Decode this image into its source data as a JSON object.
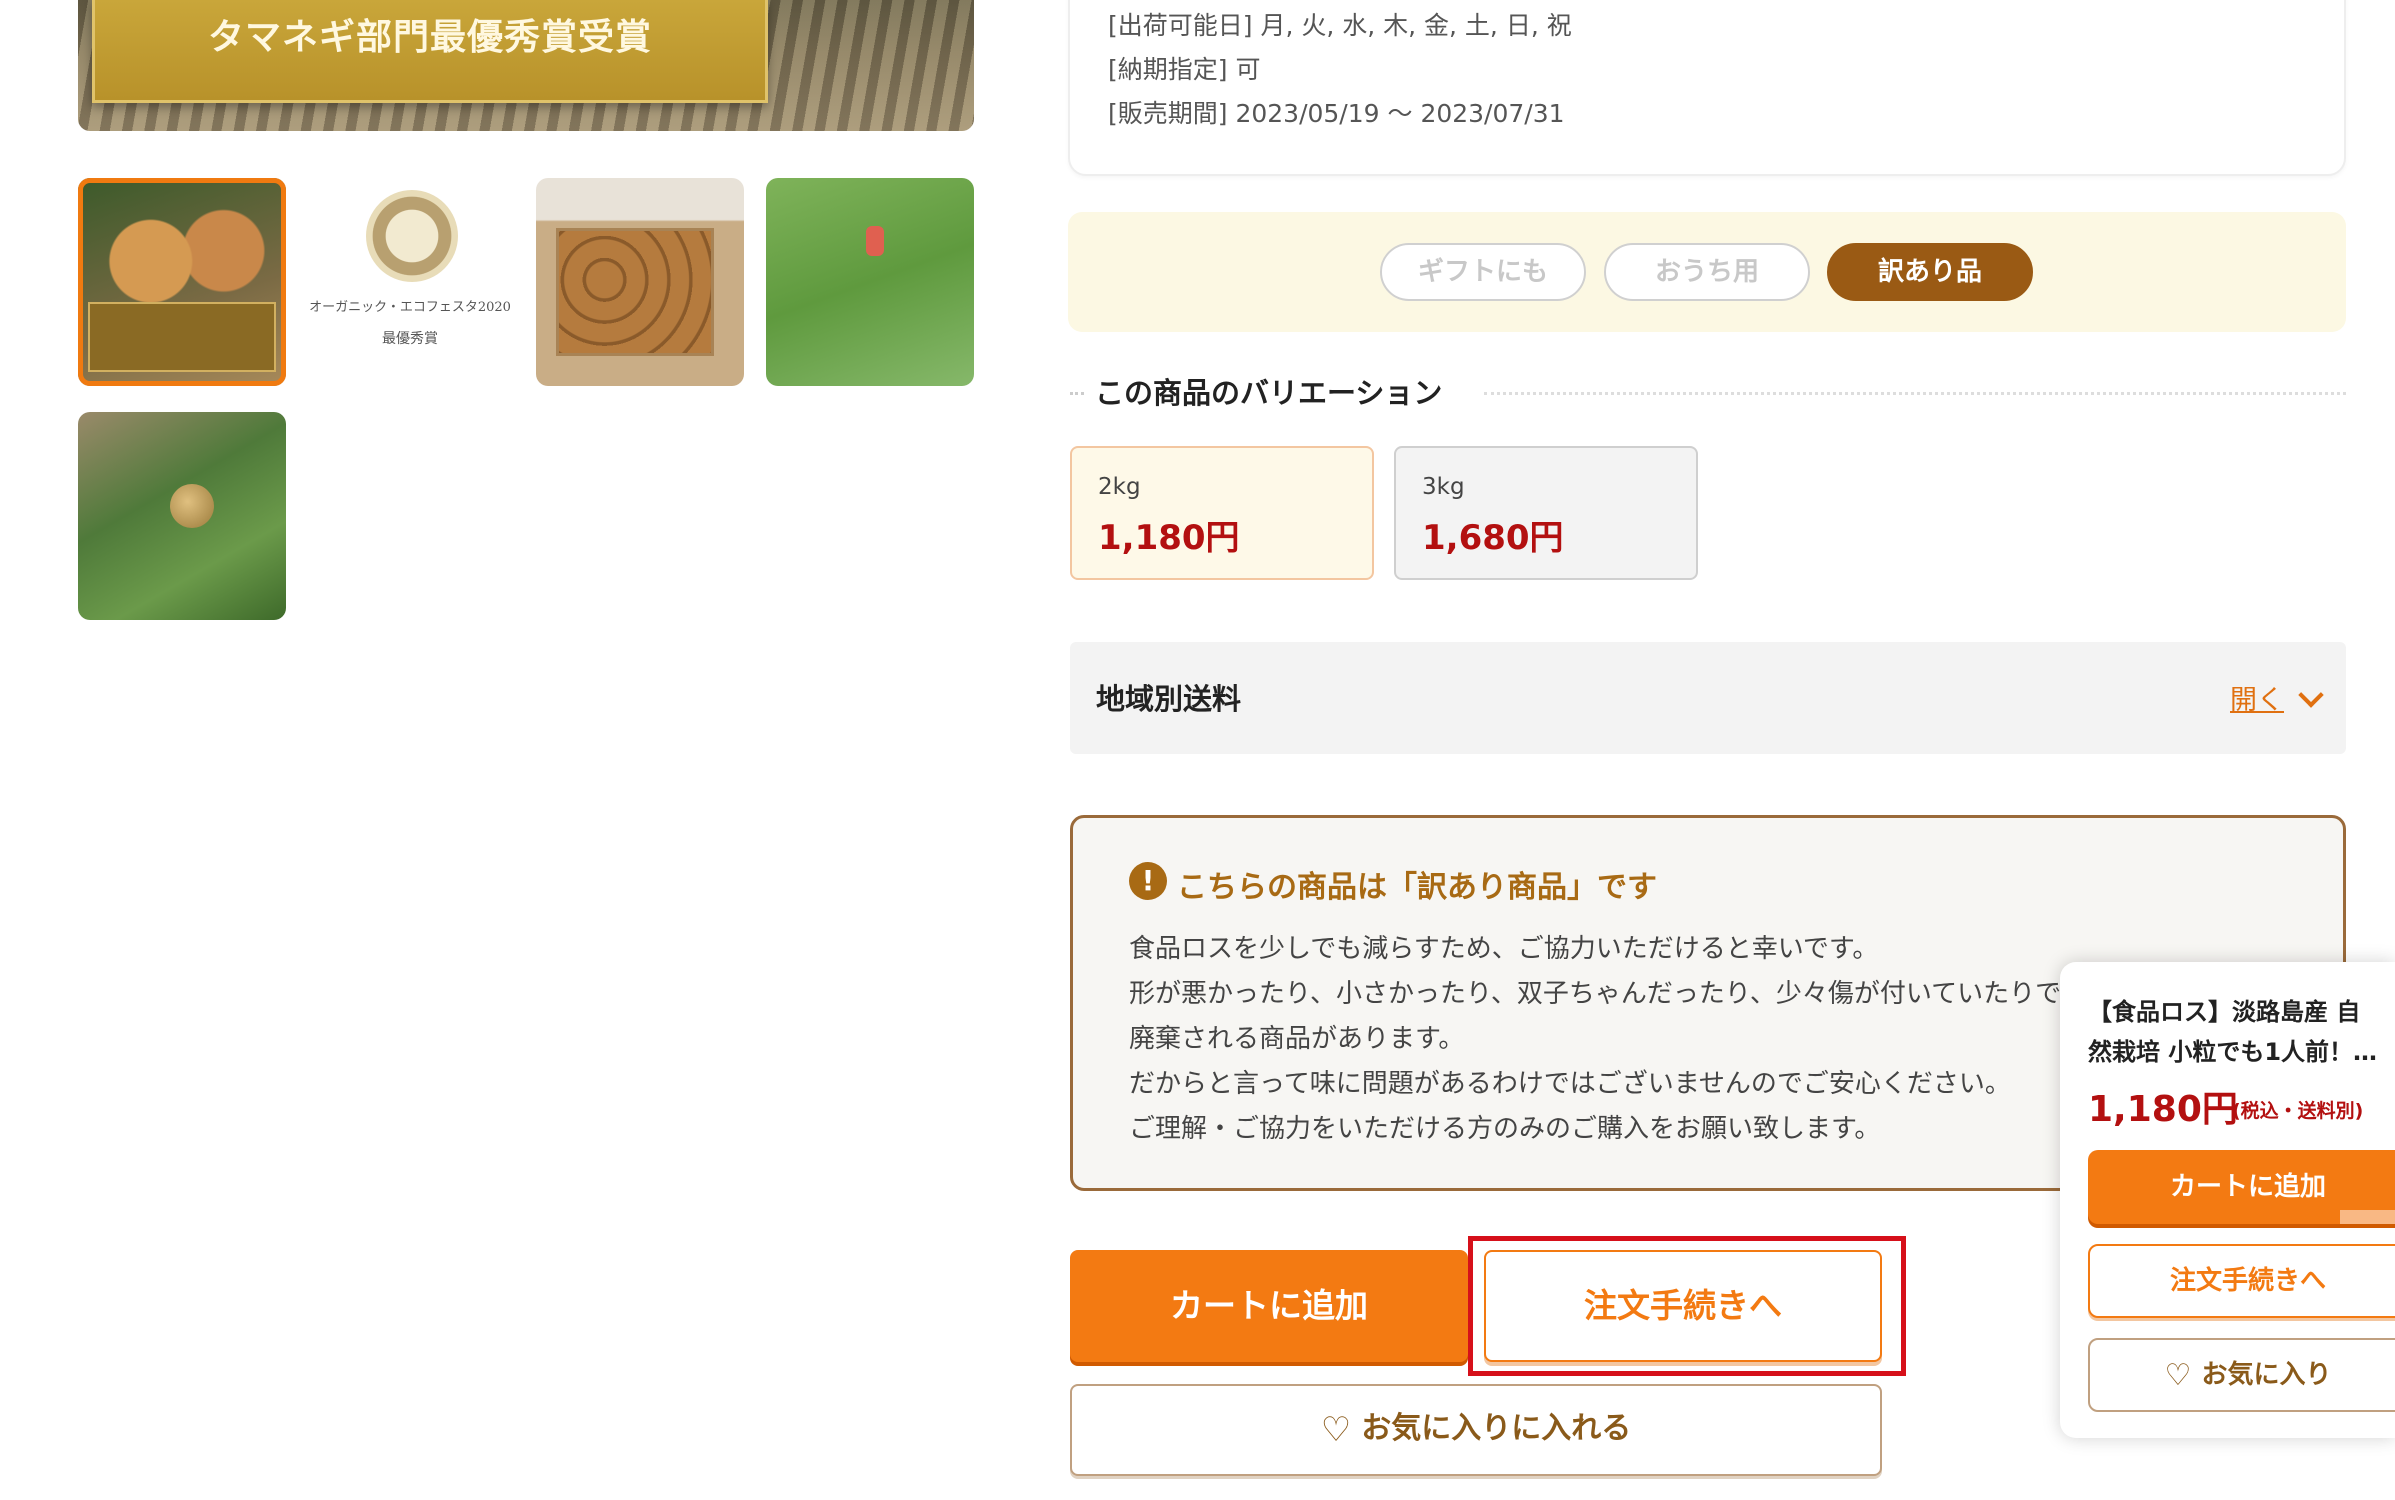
{
  "gallery": {
    "hero_banner_text": "タマネギ部門最優秀賞受賞",
    "thumb2_lines": [
      "オーガニック・エコフェスタ2020",
      "最優秀賞"
    ]
  },
  "spec": {
    "ship_days": "[出荷可能日] 月, 火, 水, 木, 金, 土, 日, 祝",
    "delivery_date": "[納期指定] 可",
    "sale_period": "[販売期間] 2023/05/19 〜 2023/07/31"
  },
  "tags": [
    {
      "label": "ギフトにも",
      "active": false
    },
    {
      "label": "おうち用",
      "active": false
    },
    {
      "label": "訳あり品",
      "active": true
    }
  ],
  "variations": {
    "title": "この商品のバリエーション",
    "items": [
      {
        "weight": "2kg",
        "price": "1,180円",
        "selected": true
      },
      {
        "weight": "3kg",
        "price": "1,680円",
        "selected": false
      }
    ]
  },
  "shipping": {
    "label": "地域別送料",
    "toggle": "開く"
  },
  "notice": {
    "heading": "こちらの商品は「訳あり商品」です",
    "lines": [
      "食品ロスを少しでも減らすため、ご協力いただけると幸いです。",
      "形が悪かったり、小さかったり、双子ちゃんだったり、少々傷が付いていたりで",
      "廃棄される商品があります。",
      "だからと言って味に問題があるわけではございませんのでご安心ください。",
      "ご理解・ご協力をいただける方のみのご購入をお願い致します。"
    ]
  },
  "actions": {
    "add_to_cart": "カートに追加",
    "checkout": "注文手続きへ",
    "favorite": "お気に入りに入れる"
  },
  "mini_panel": {
    "title_line1": "【食品ロス】淡路島産 自",
    "title_line2": "然栽培 小粒でも1人前！…",
    "price": "1,180円",
    "price_note": "(税込・送料別)",
    "add_to_cart": "カートに追加",
    "checkout": "注文手続きへ",
    "favorite": "お気に入り"
  },
  "colors": {
    "accent_orange": "#f37a12",
    "price_red": "#b31010",
    "brown": "#9a5a14",
    "highlight_red": "#d6101a"
  }
}
